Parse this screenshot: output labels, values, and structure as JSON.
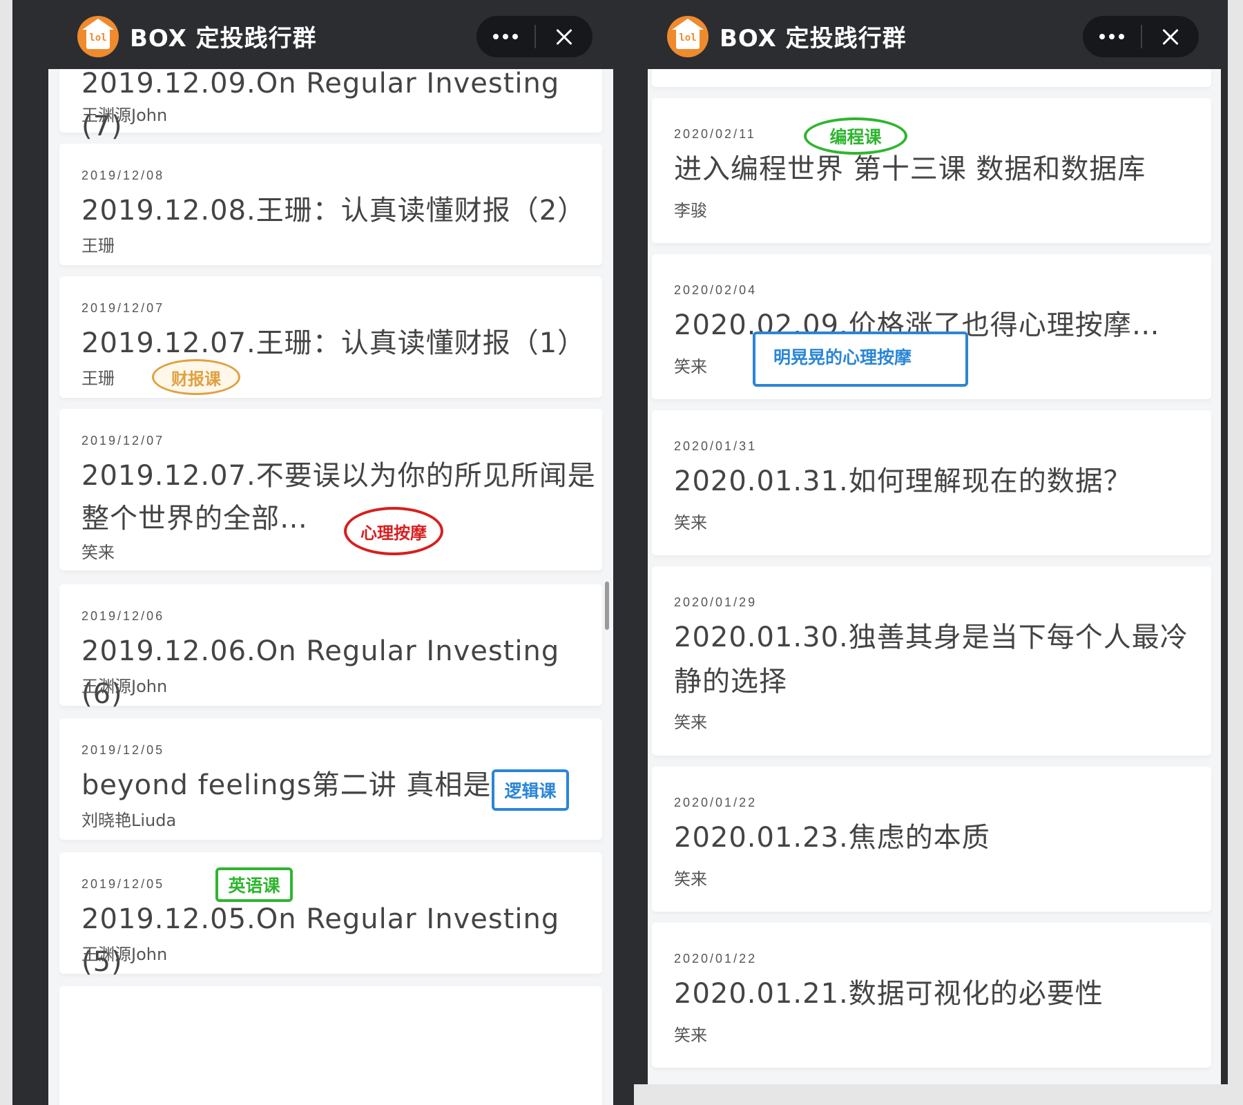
{
  "app": {
    "title": "BOX 定投践行群",
    "logo_text": "lol"
  },
  "left_panel": {
    "partial_top": {
      "title": "2019.12.09.On Regular Investing (7)",
      "author": "王渊源John"
    },
    "cards": [
      {
        "date": "2019/12/08",
        "title": "2019.12.08.王珊：认真读懂财报（2）",
        "author": "王珊"
      },
      {
        "date": "2019/12/07",
        "title": "2019.12.07.王珊：认真读懂财报（1）",
        "author": "王珊"
      },
      {
        "date": "2019/12/07",
        "title_line1": "2019.12.07.不要误以为你的所见所闻是",
        "title_line2": "整个世界的全部…",
        "author": "笑来"
      },
      {
        "date": "2019/12/06",
        "title": "2019.12.06.On Regular Investing (6)",
        "author": "王渊源John"
      },
      {
        "date": "2019/12/05",
        "title": "beyond feelings第二讲 真相是什么",
        "author": "刘晓艳Liuda"
      },
      {
        "date": "2019/12/05",
        "title": "2019.12.05.On Regular Investing (5)",
        "author": "王渊源John"
      }
    ],
    "tags": {
      "finance": "财报课",
      "psych": "心理按摩",
      "logic": "逻辑课",
      "english": "英语课"
    }
  },
  "right_panel": {
    "cards": [
      {
        "date": "2020/02/11",
        "title": "进入编程世界 第十三课 数据和数据库",
        "author": "李骏"
      },
      {
        "date": "2020/02/04",
        "title": "2020.02.09.价格涨了也得心理按摩…",
        "author": "笑来"
      },
      {
        "date": "2020/01/31",
        "title": "2020.01.31.如何理解现在的数据？",
        "author": "笑来"
      },
      {
        "date": "2020/01/29",
        "title_line1": "2020.01.30.独善其身是当下每个人最冷",
        "title_line2": "静的选择",
        "author": "笑来"
      },
      {
        "date": "2020/01/22",
        "title": "2020.01.23.焦虑的本质",
        "author": "笑来"
      },
      {
        "date": "2020/01/22",
        "title": "2020.01.21.数据可视化的必要性",
        "author": "笑来"
      }
    ],
    "tags": {
      "programming": "编程课",
      "obvious_psych": "明晃晃的心理按摩"
    }
  },
  "colors": {
    "titlebar": "#2b2d31",
    "logo": "#ef8a2d",
    "tag_orange": "#e0a040",
    "tag_red": "#d81e1e",
    "tag_blue": "#2a86d6",
    "tag_green": "#2fb52f"
  },
  "icons": {
    "more": "more-dots-icon",
    "close": "close-icon",
    "logo": "house-logo-icon"
  }
}
